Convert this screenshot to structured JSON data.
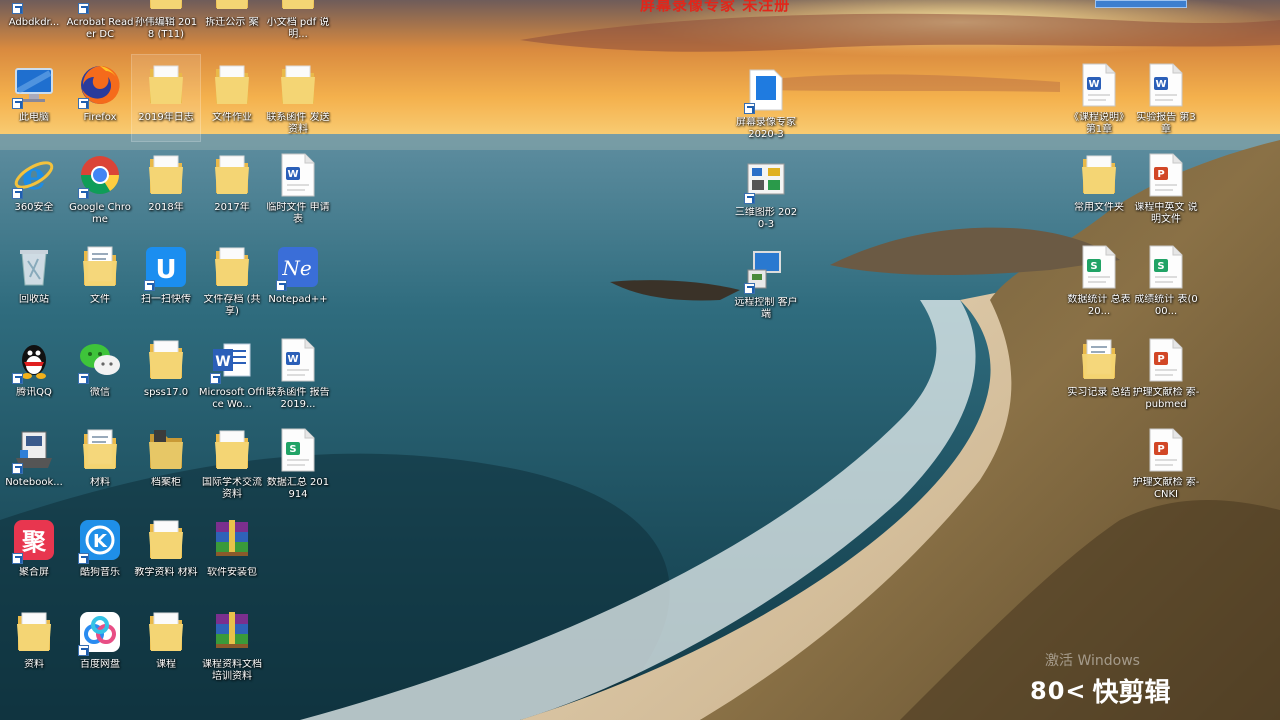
{
  "screen": {
    "banner": "屏幕录像专家 未注册",
    "activate": "激活 Windows",
    "watermark_logo": "80<",
    "watermark_text": "快剪辑"
  },
  "colors": {
    "folder": "#f4d574",
    "word": "#2b5fb8",
    "excel": "#21a366",
    "ppt": "#d24726"
  },
  "icons": [
    {
      "label": "Adbdkdr...",
      "type": "red-app"
    },
    {
      "label": "Acrobat Reader DC",
      "type": "red-app"
    },
    {
      "label": "孙伟编辑 2018 (T11)",
      "type": "folder"
    },
    {
      "label": "拆迁公示 案",
      "type": "folder"
    },
    {
      "label": "小文档 pdf 说明...",
      "type": "folder"
    },
    {
      "label": "此电脑",
      "type": "pc"
    },
    {
      "label": "Firefox",
      "type": "firefox"
    },
    {
      "label": "2019年日志",
      "type": "folder"
    },
    {
      "label": "文件作业",
      "type": "folder"
    },
    {
      "label": "联系函件 发送资料",
      "type": "folder"
    },
    {
      "label": "360安全",
      "type": "ie"
    },
    {
      "label": "Google Chrome",
      "type": "chrome"
    },
    {
      "label": "2018年",
      "type": "folder"
    },
    {
      "label": "2017年",
      "type": "folder"
    },
    {
      "label": "临时文件 申请表",
      "type": "word"
    },
    {
      "label": "回收站",
      "type": "recycle"
    },
    {
      "label": "文件",
      "type": "folder-doc"
    },
    {
      "label": "扫一扫快传",
      "type": "blue-u"
    },
    {
      "label": "文件存档 (共享)",
      "type": "folder"
    },
    {
      "label": "Notepad++",
      "type": "notepad"
    },
    {
      "label": "腾讯QQ",
      "type": "qq"
    },
    {
      "label": "微信",
      "type": "wechat"
    },
    {
      "label": "spss17.0",
      "type": "folder"
    },
    {
      "label": "Microsoft Office Wo...",
      "type": "office"
    },
    {
      "label": "联系函件 报告2019...",
      "type": "word"
    },
    {
      "label": "Notebook...",
      "type": "notebook"
    },
    {
      "label": "材料",
      "type": "folder-doc"
    },
    {
      "label": "档案柜",
      "type": "folder-dark"
    },
    {
      "label": "国际学术交流 资料",
      "type": "folder"
    },
    {
      "label": "数据汇总 201914",
      "type": "excel"
    },
    {
      "label": "聚合屏",
      "type": "ju"
    },
    {
      "label": "酷狗音乐",
      "type": "kugou"
    },
    {
      "label": "教学资料 材料",
      "type": "folder"
    },
    {
      "label": "软件安装包",
      "type": "rar"
    },
    {
      "label": "资料",
      "type": "folder"
    },
    {
      "label": "百度网盘",
      "type": "baidu"
    },
    {
      "label": "课程",
      "type": "folder"
    },
    {
      "label": "课程资料文档 培训资料",
      "type": "rar"
    },
    {
      "label": "屏幕录像专家 2020-3",
      "type": "blue-file"
    },
    {
      "label": "三维图形 2020-3",
      "type": "diagram-app"
    },
    {
      "label": "远程控制 客户端",
      "type": "remote-pc"
    },
    {
      "label": "《课程说明》 第1章",
      "type": "word"
    },
    {
      "label": "实验报告 第3章",
      "type": "word"
    },
    {
      "label": "常用文件夹",
      "type": "folder"
    },
    {
      "label": "课程中英文 说明文件",
      "type": "ppt"
    },
    {
      "label": "数据统计 总表20...",
      "type": "excel"
    },
    {
      "label": "成绩统计 表(000...",
      "type": "excel"
    },
    {
      "label": "实习记录 总结",
      "type": "folder-doc"
    },
    {
      "label": "护理文献检 索-pubmed",
      "type": "ppt"
    },
    {
      "label": "护理文献检 索-CNKI",
      "type": "ppt"
    }
  ]
}
